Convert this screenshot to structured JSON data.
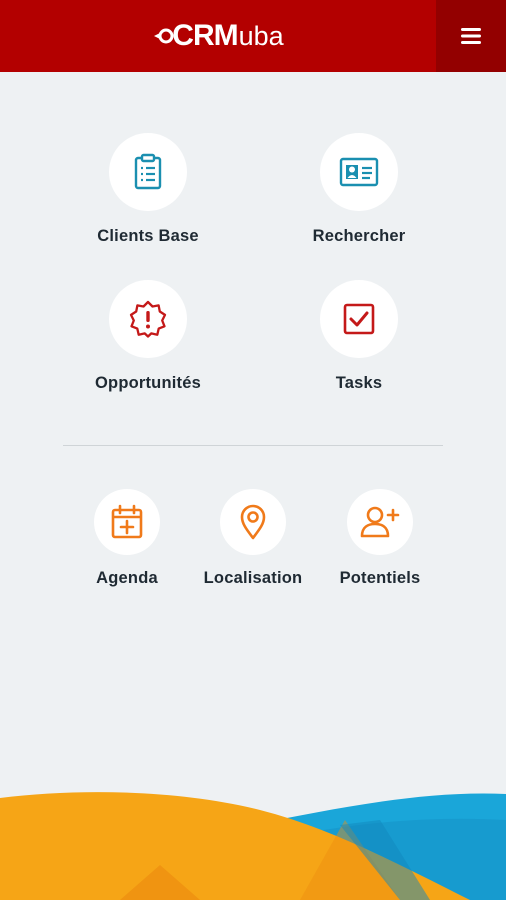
{
  "header": {
    "brand_bold": "CRM",
    "brand_light": "uba",
    "menu_icon": "hamburger-menu-icon",
    "color": "#b30000"
  },
  "main_tiles": [
    {
      "label": "Clients Base",
      "icon": "clipboard-list-icon",
      "color": "#1a8fb0"
    },
    {
      "label": "Rechercher",
      "icon": "id-card-icon",
      "color": "#1a8fb0"
    },
    {
      "label": "Opportunités",
      "icon": "alert-badge-icon",
      "color": "#c41919"
    },
    {
      "label": "Tasks",
      "icon": "checkbox-icon",
      "color": "#c41919"
    }
  ],
  "secondary_tiles": [
    {
      "label": "Agenda",
      "icon": "calendar-plus-icon",
      "color": "#f07a1a"
    },
    {
      "label": "Localisation",
      "icon": "map-pin-icon",
      "color": "#f07a1a"
    },
    {
      "label": "Potentiels",
      "icon": "user-plus-icon",
      "color": "#f07a1a"
    }
  ]
}
